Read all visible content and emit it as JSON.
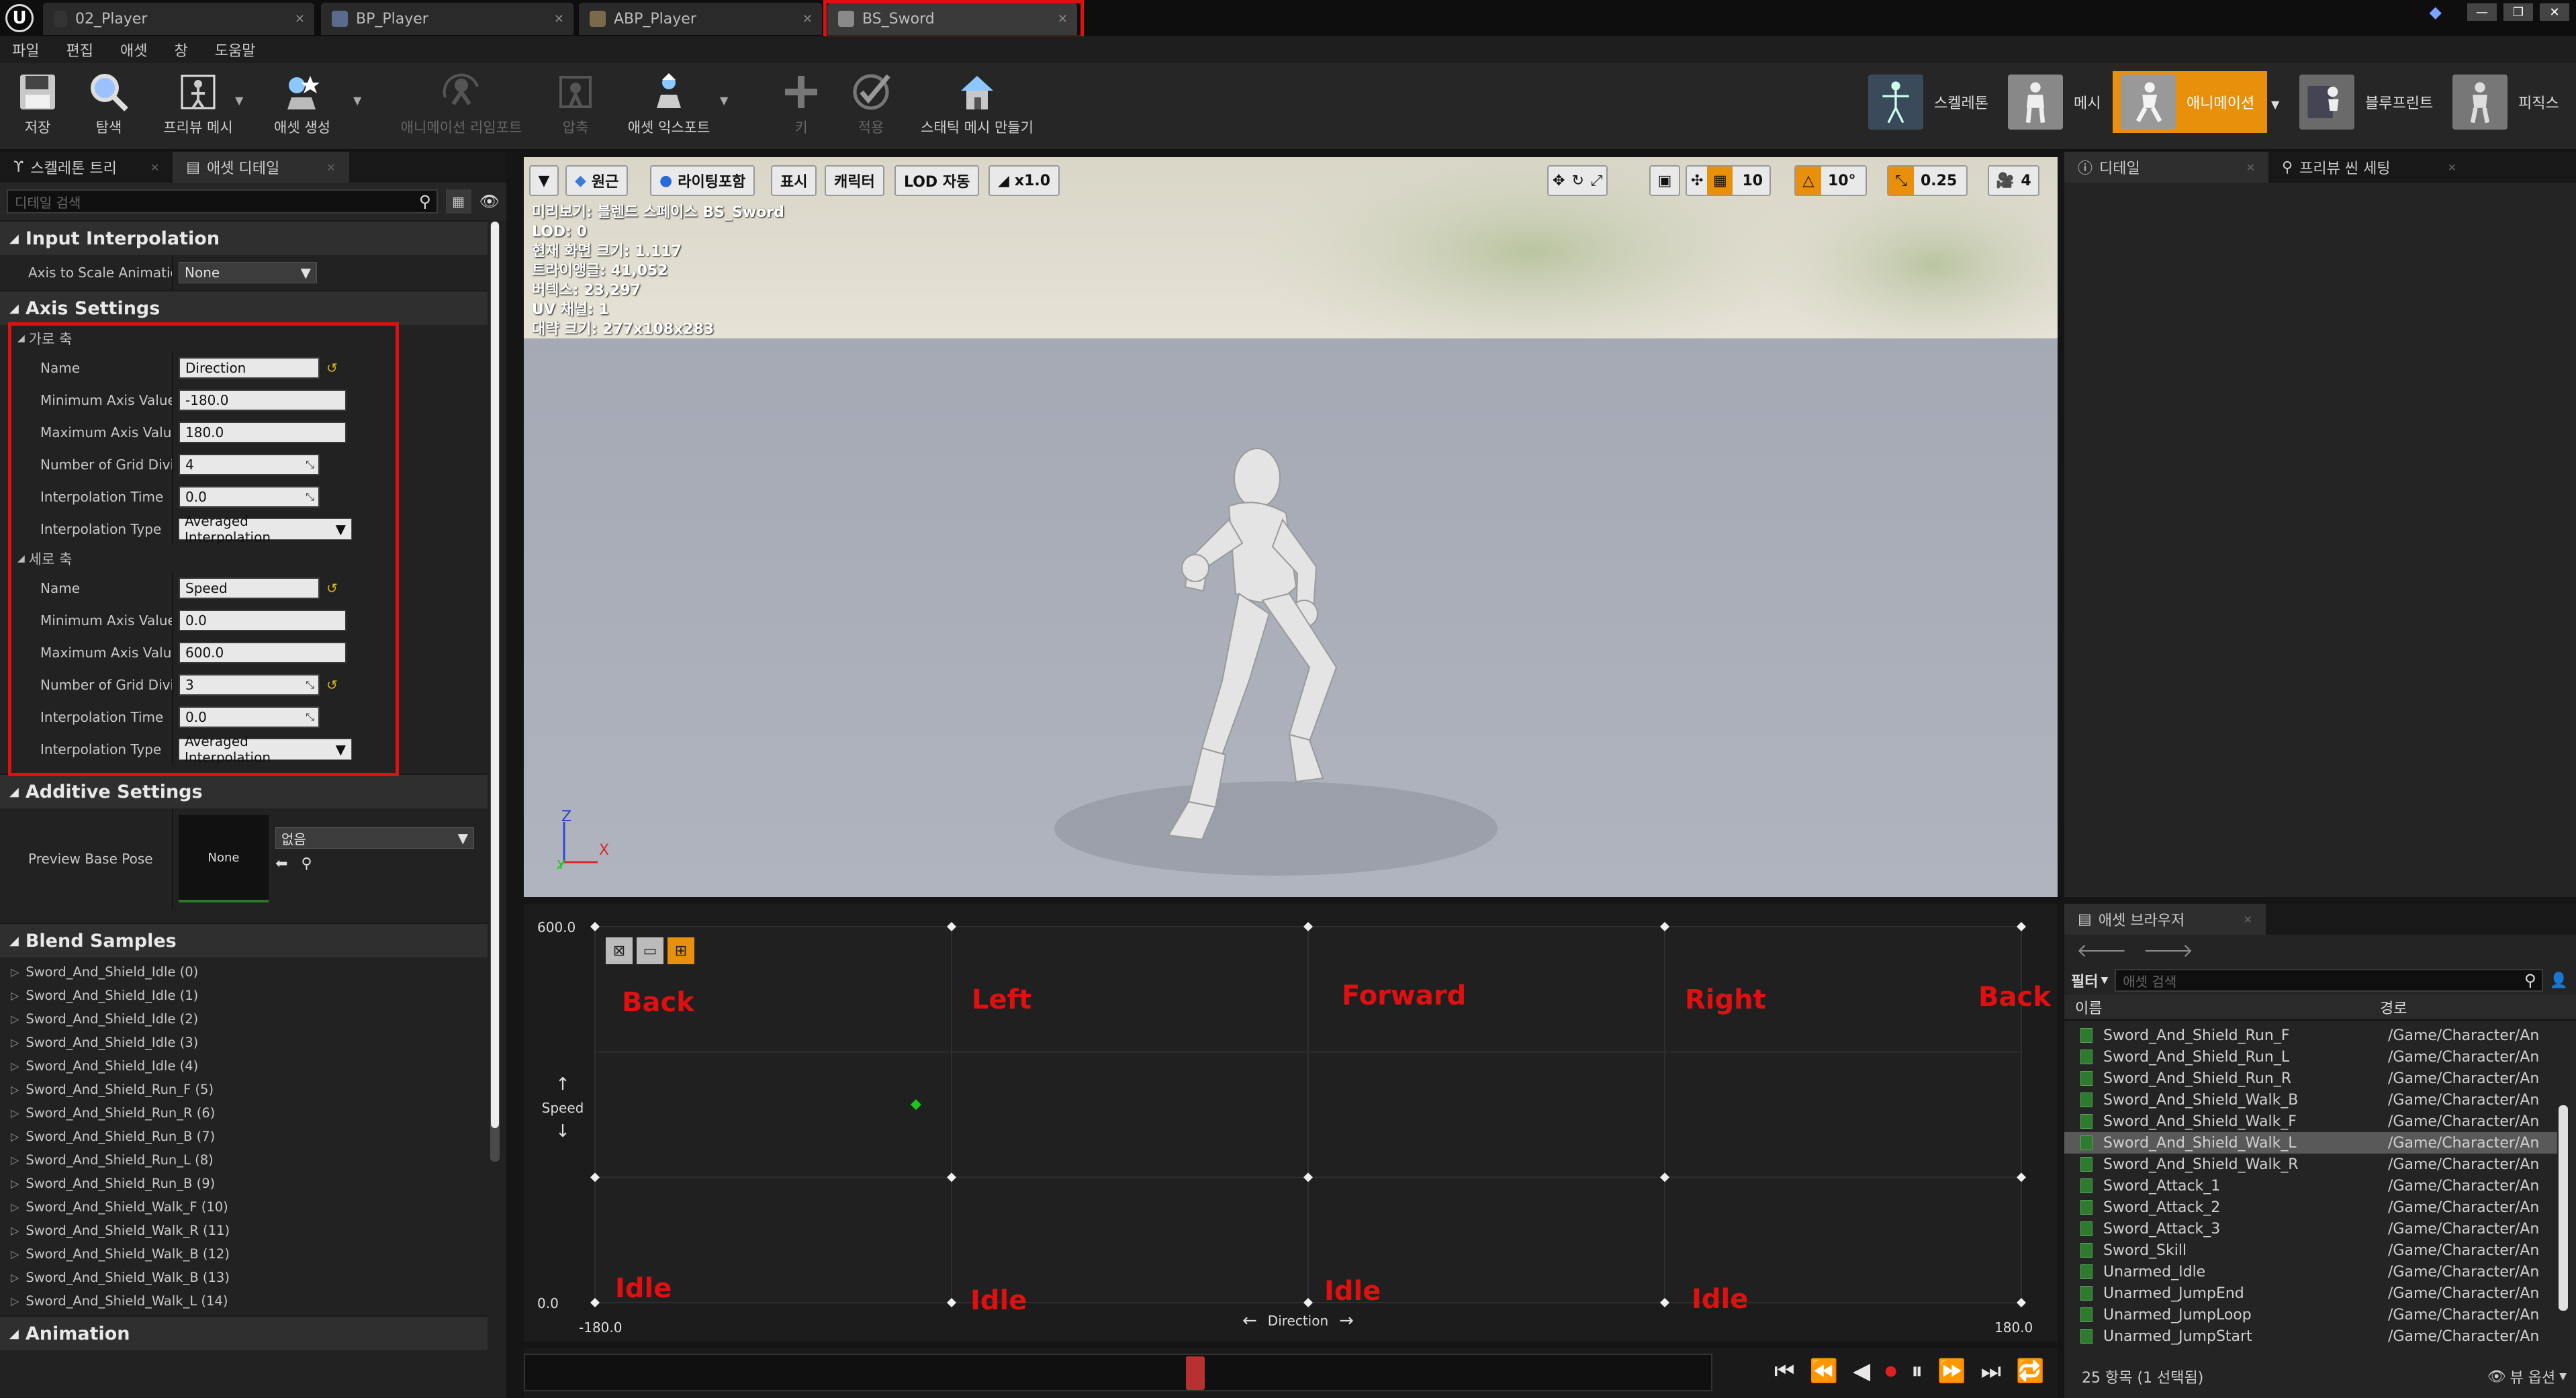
{
  "tabs": [
    "02_Player",
    "BP_Player",
    "ABP_Player",
    "BS_Sword"
  ],
  "menu": [
    "파일",
    "편집",
    "애셋",
    "창",
    "도움말"
  ],
  "toolbar": {
    "save": "저장",
    "browse": "탐색",
    "preview_mesh": "프리뷰 메시",
    "create_asset": "애셋 생성",
    "reimport": "애니메이션 리임포트",
    "compress": "압축",
    "export_asset": "애셋 익스포트",
    "key": "키",
    "apply": "적용",
    "make_static_mesh": "스태틱 메시 만들기"
  },
  "modes": [
    "스켈레톤",
    "메시",
    "애니메이션",
    "블루프린트",
    "피직스"
  ],
  "left_panel": {
    "tabs": [
      "스켈레톤 트리",
      "애셋 디테일"
    ],
    "search_placeholder": "디테일 검색",
    "input_interpolation": {
      "header": "Input Interpolation",
      "axis_to_scale_label": "Axis to Scale Animatior",
      "axis_to_scale_value": "None"
    },
    "axis_settings": {
      "header": "Axis Settings",
      "horizontal": {
        "title": "가로 축",
        "name_label": "Name",
        "name": "Direction",
        "min_label": "Minimum Axis Value",
        "min": "-180.0",
        "max_label": "Maximum Axis Value",
        "max": "180.0",
        "grid_label": "Number of Grid Divisi",
        "grid": "4",
        "interp_time_label": "Interpolation Time",
        "interp_time": "0.0",
        "interp_type_label": "Interpolation Type",
        "interp_type": "Averaged Interpolation"
      },
      "vertical": {
        "title": "세로 축",
        "name_label": "Name",
        "name": "Speed",
        "min_label": "Minimum Axis Value",
        "min": "0.0",
        "max_label": "Maximum Axis Value",
        "max": "600.0",
        "grid_label": "Number of Grid Divisi",
        "grid": "3",
        "interp_time_label": "Interpolation Time",
        "interp_time": "0.0",
        "interp_type_label": "Interpolation Type",
        "interp_type": "Averaged Interpolation"
      }
    },
    "additive": {
      "header": "Additive Settings",
      "preview_label": "Preview Base Pose",
      "thumb_label": "None",
      "combo_value": "없음"
    },
    "blend_samples_header": "Blend Samples",
    "blend_samples": [
      "Sword_And_Shield_Idle (0)",
      "Sword_And_Shield_Idle (1)",
      "Sword_And_Shield_Idle (2)",
      "Sword_And_Shield_Idle (3)",
      "Sword_And_Shield_Idle (4)",
      "Sword_And_Shield_Run_F (5)",
      "Sword_And_Shield_Run_R (6)",
      "Sword_And_Shield_Run_B (7)",
      "Sword_And_Shield_Run_L (8)",
      "Sword_And_Shield_Run_B (9)",
      "Sword_And_Shield_Walk_F (10)",
      "Sword_And_Shield_Walk_R (11)",
      "Sword_And_Shield_Walk_B (12)",
      "Sword_And_Shield_Walk_B (13)",
      "Sword_And_Shield_Walk_L (14)"
    ],
    "animation_header": "Animation"
  },
  "viewport": {
    "buttons": [
      "원근",
      "라이팅포함",
      "표시",
      "캐릭터",
      "LOD 자동",
      "x1.0"
    ],
    "right_values": [
      "10",
      "10°",
      "0.25",
      "4"
    ],
    "stats": [
      "미리보기: 블렌드 스페이스 BS_Sword",
      "LOD: 0",
      "현재 화면 크기: 1.117",
      "트라이앵글: 41,052",
      "버텍스: 23,297",
      "UV 채널: 1",
      "대략 크기: 277x108x283"
    ],
    "axis_z": "Z",
    "axis_y": "Y",
    "axis_x": "X"
  },
  "blend_space": {
    "y_max": "600.0",
    "y_min": "0.0",
    "x_min": "-180.0",
    "x_max": "180.0",
    "x_axis_name": "Direction",
    "y_axis_name": "Speed",
    "top_labels": [
      "Back",
      "Left",
      "Forward",
      "Right",
      "Back"
    ],
    "bottom_labels": [
      "Idle",
      "Idle",
      "Idle",
      "Idle"
    ],
    "label_color": "#e01010",
    "preview_point": {
      "direction": -99,
      "speed": 316
    }
  },
  "right_panel": {
    "tabs": [
      "디테일",
      "프리뷰 씬 세팅"
    ]
  },
  "content_browser": {
    "tab": "애셋 브라우저",
    "filter": "필터",
    "search_placeholder": "애셋 검색",
    "col_name": "이름",
    "col_path": "경로",
    "assets": [
      {
        "name": "Sword_And_Shield_Run_F",
        "path": "/Game/Character/An"
      },
      {
        "name": "Sword_And_Shield_Run_L",
        "path": "/Game/Character/An"
      },
      {
        "name": "Sword_And_Shield_Run_R",
        "path": "/Game/Character/An"
      },
      {
        "name": "Sword_And_Shield_Walk_B",
        "path": "/Game/Character/An"
      },
      {
        "name": "Sword_And_Shield_Walk_F",
        "path": "/Game/Character/An"
      },
      {
        "name": "Sword_And_Shield_Walk_L",
        "path": "/Game/Character/An"
      },
      {
        "name": "Sword_And_Shield_Walk_R",
        "path": "/Game/Character/An"
      },
      {
        "name": "Sword_Attack_1",
        "path": "/Game/Character/An"
      },
      {
        "name": "Sword_Attack_2",
        "path": "/Game/Character/An"
      },
      {
        "name": "Sword_Attack_3",
        "path": "/Game/Character/An"
      },
      {
        "name": "Sword_Skill",
        "path": "/Game/Character/An"
      },
      {
        "name": "Unarmed_Idle",
        "path": "/Game/Character/An"
      },
      {
        "name": "Unarmed_JumpEnd",
        "path": "/Game/Character/An"
      },
      {
        "name": "Unarmed_JumpLoop",
        "path": "/Game/Character/An"
      },
      {
        "name": "Unarmed_JumpStart",
        "path": "/Game/Character/An"
      }
    ],
    "selected_index": 5,
    "status": "25 항목 (1 선택됨)",
    "view_options": "뷰 옵션"
  },
  "colors": {
    "accent": "#e8900c",
    "highlight": "#e01010"
  }
}
